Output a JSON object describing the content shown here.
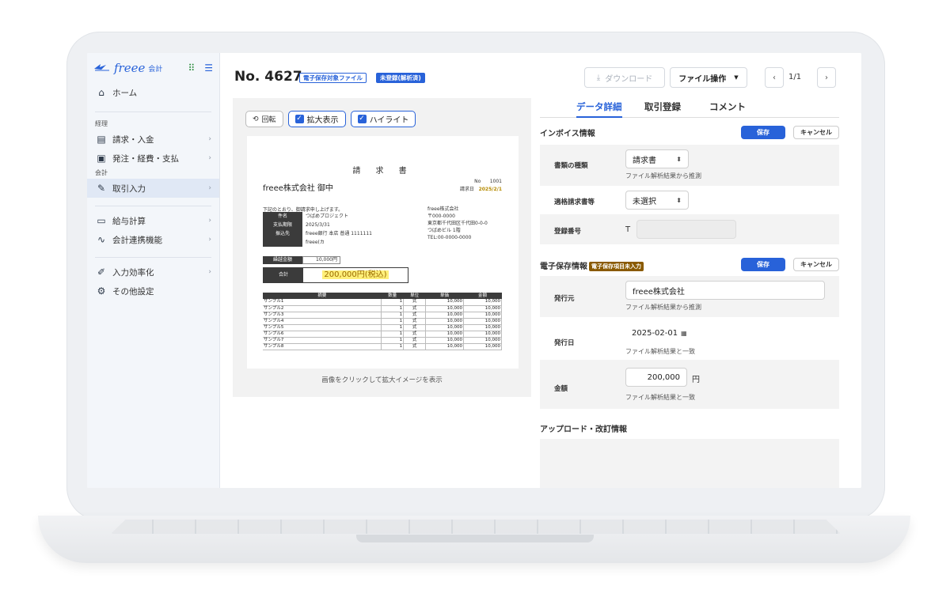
{
  "sidebar": {
    "logo_text": "freee",
    "logo_sub": "会計",
    "items": [
      {
        "label": "ホーム",
        "icon": "home-icon"
      },
      {
        "label": "請求・入金",
        "icon": "invoice-icon"
      },
      {
        "label": "発注・経費・支払",
        "icon": "payment-icon"
      },
      {
        "label": "取引入力",
        "icon": "pen-icon"
      },
      {
        "label": "給与計算",
        "icon": "payroll-icon"
      },
      {
        "label": "会計連携機能",
        "icon": "link-icon"
      },
      {
        "label": "入力効率化",
        "icon": "efficiency-icon"
      },
      {
        "label": "その他設定",
        "icon": "gear-icon"
      }
    ],
    "sections": {
      "keiri": "経理",
      "kaikei": "会計"
    }
  },
  "header": {
    "title": "No. 4627",
    "tag_file": "電子保存対象ファイル",
    "tag_status": "未登録(解析済)",
    "download_label": "ダウンロード",
    "file_ops_label": "ファイル操作",
    "page_indicator": "1/1"
  },
  "preview": {
    "rotate_label": "回転",
    "zoom_label": "拡大表示",
    "highlight_label": "ハイライト",
    "caption": "画像をクリックして拡大イメージを表示",
    "invoice": {
      "title": "請 求 書",
      "to": "freee株式会社 御中",
      "no_label": "No",
      "no_value": "1001",
      "date_label": "請求日",
      "date_value": "2025/2/1",
      "message": "下記のとおり、御請求申し上げます。",
      "kv": [
        {
          "k": "件名",
          "v": "つばめプロジェクト"
        },
        {
          "k": "支払期限",
          "v": "2025/3/31"
        },
        {
          "k": "振込先",
          "v": "freee銀行 本店 普通 1111111"
        },
        {
          "k": "",
          "v": "freee(カ"
        }
      ],
      "from": [
        "freee株式会社",
        "〒000-0000",
        "東京都千代田区千代田0-0-0",
        "つばめビル 1階",
        "TEL:00-0000-0000"
      ],
      "subtotal_label": "繰越金額",
      "subtotal_value": "10,000円",
      "total_label": "合計",
      "total_value": "200,000円(税込)",
      "columns": [
        "摘要",
        "数量",
        "単位",
        "単価",
        "金額"
      ],
      "rows": [
        [
          "サンプル1",
          "1",
          "式",
          "10,000",
          "10,000"
        ],
        [
          "サンプル2",
          "1",
          "式",
          "10,000",
          "10,000"
        ],
        [
          "サンプル3",
          "1",
          "式",
          "10,000",
          "10,000"
        ],
        [
          "サンプル4",
          "1",
          "式",
          "10,000",
          "10,000"
        ],
        [
          "サンプル5",
          "1",
          "式",
          "10,000",
          "10,000"
        ],
        [
          "サンプル6",
          "1",
          "式",
          "10,000",
          "10,000"
        ],
        [
          "サンプル7",
          "1",
          "式",
          "10,000",
          "10,000"
        ],
        [
          "サンプル8",
          "1",
          "式",
          "10,000",
          "10,000"
        ]
      ]
    }
  },
  "detail": {
    "tabs": [
      "データ詳細",
      "取引登録",
      "コメント"
    ],
    "invoice_section": "インボイス情報",
    "storage_section": "電子保存情報",
    "storage_badge": "電子保存項目未入力",
    "save_label": "保存",
    "cancel_label": "キャンセル",
    "doc_type_label": "書類の種類",
    "doc_type_value": "請求書",
    "doc_type_hint": "ファイル解析結果から推測",
    "qualified_label": "適格請求書等",
    "qualified_value": "未選択",
    "reg_no_label": "登録番号",
    "reg_no_prefix": "T",
    "issuer_label": "発行元",
    "issuer_value": "freee株式会社",
    "issuer_hint": "ファイル解析結果から推測",
    "issue_date_label": "発行日",
    "issue_date_value": "2025-02-01",
    "issue_date_hint": "ファイル解析結果と一致",
    "amount_label": "金額",
    "amount_value": "200,000",
    "amount_unit": "円",
    "amount_hint": "ファイル解析結果と一致",
    "upload_section": "アップロード・改訂情報"
  }
}
